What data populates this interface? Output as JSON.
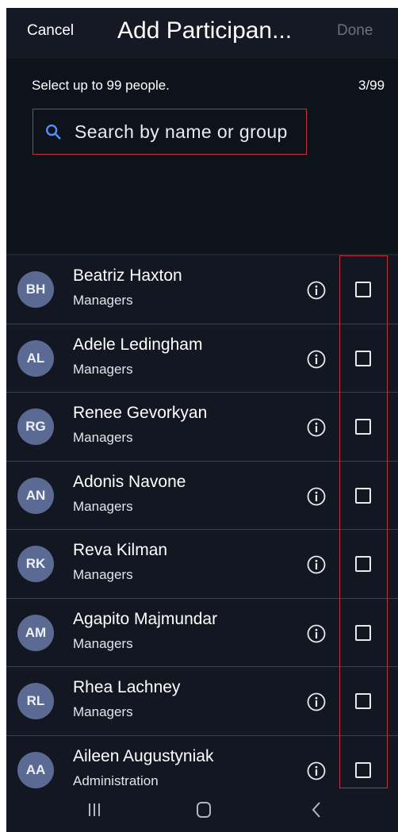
{
  "header": {
    "cancel_label": "Cancel",
    "title": "Add Participan...",
    "done_label": "Done"
  },
  "selection": {
    "hint": "Select up to 99 people.",
    "count": "3/99"
  },
  "search": {
    "placeholder": "Search by name or group",
    "icon": "search-icon"
  },
  "participants": [
    {
      "initials": "BH",
      "name": "Beatriz Haxton",
      "group": "Managers",
      "checked": false
    },
    {
      "initials": "AL",
      "name": "Adele Ledingham",
      "group": "Managers",
      "checked": false
    },
    {
      "initials": "RG",
      "name": "Renee Gevorkyan",
      "group": "Managers",
      "checked": false
    },
    {
      "initials": "AN",
      "name": "Adonis Navone",
      "group": "Managers",
      "checked": false
    },
    {
      "initials": "RK",
      "name": "Reva Kilman",
      "group": "Managers",
      "checked": false
    },
    {
      "initials": "AM",
      "name": "Agapito Majmundar",
      "group": "Managers",
      "checked": false
    },
    {
      "initials": "RL",
      "name": "Rhea Lachney",
      "group": "Managers",
      "checked": false
    },
    {
      "initials": "AA",
      "name": "Aileen Augustyniak",
      "group": "Administration",
      "checked": false
    }
  ],
  "navigation": {
    "recents_icon": "recents-icon",
    "home_icon": "home-icon",
    "back_icon": "back-icon"
  },
  "colors": {
    "background": "#131722",
    "avatar": "#5a6a92",
    "highlight": "#c2313d",
    "search_icon": "#4f8ff7"
  }
}
